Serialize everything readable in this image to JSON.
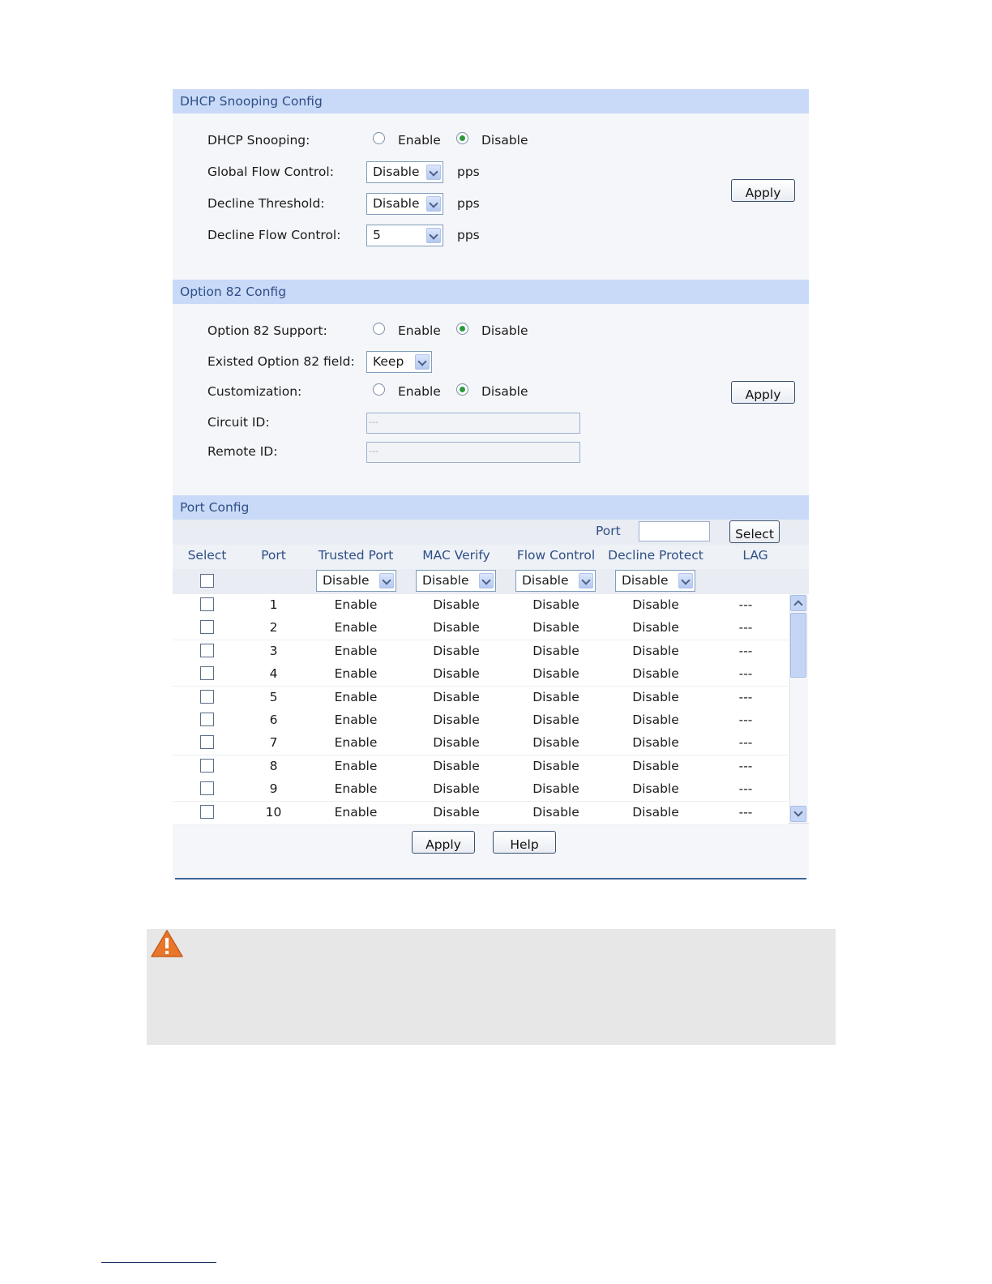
{
  "dhcp_snooping_config": {
    "title": "DHCP Snooping Config",
    "dhcp_snooping_label": "DHCP Snooping:",
    "enable_label": "Enable",
    "disable_label": "Disable",
    "selected": "Disable",
    "global_flow_control_label": "Global Flow Control:",
    "global_flow_control_value": "Disable",
    "decline_threshold_label": "Decline Threshold:",
    "decline_threshold_value": "Disable",
    "decline_flow_control_label": "Decline Flow Control:",
    "decline_flow_control_value": "5",
    "unit": "pps",
    "apply_label": "Apply"
  },
  "option82_config": {
    "title": "Option 82 Config",
    "support_label": "Option 82 Support:",
    "support_selected": "Disable",
    "existed_field_label": "Existed Option 82 field:",
    "existed_field_value": "Keep",
    "customization_label": "Customization:",
    "customization_selected": "Disable",
    "enable_label": "Enable",
    "disable_label": "Disable",
    "circuit_id_label": "Circuit ID:",
    "circuit_id_placeholder": "---",
    "remote_id_label": "Remote ID:",
    "remote_id_placeholder": "---",
    "apply_label": "Apply"
  },
  "port_config": {
    "title": "Port Config",
    "port_label": "Port",
    "select_button": "Select",
    "columns": [
      "Select",
      "Port",
      "Trusted Port",
      "MAC Verify",
      "Flow Control",
      "Decline Protect",
      "LAG"
    ],
    "batch_values": [
      "Disable",
      "Disable",
      "Disable",
      "Disable"
    ],
    "rows": [
      {
        "port": "1",
        "trusted": "Enable",
        "mac_verify": "Disable",
        "flow_control": "Disable",
        "decline_protect": "Disable",
        "lag": "---"
      },
      {
        "port": "2",
        "trusted": "Enable",
        "mac_verify": "Disable",
        "flow_control": "Disable",
        "decline_protect": "Disable",
        "lag": "---"
      },
      {
        "port": "3",
        "trusted": "Enable",
        "mac_verify": "Disable",
        "flow_control": "Disable",
        "decline_protect": "Disable",
        "lag": "---"
      },
      {
        "port": "4",
        "trusted": "Enable",
        "mac_verify": "Disable",
        "flow_control": "Disable",
        "decline_protect": "Disable",
        "lag": "---"
      },
      {
        "port": "5",
        "trusted": "Enable",
        "mac_verify": "Disable",
        "flow_control": "Disable",
        "decline_protect": "Disable",
        "lag": "---"
      },
      {
        "port": "6",
        "trusted": "Enable",
        "mac_verify": "Disable",
        "flow_control": "Disable",
        "decline_protect": "Disable",
        "lag": "---"
      },
      {
        "port": "7",
        "trusted": "Enable",
        "mac_verify": "Disable",
        "flow_control": "Disable",
        "decline_protect": "Disable",
        "lag": "---"
      },
      {
        "port": "8",
        "trusted": "Enable",
        "mac_verify": "Disable",
        "flow_control": "Disable",
        "decline_protect": "Disable",
        "lag": "---"
      },
      {
        "port": "9",
        "trusted": "Enable",
        "mac_verify": "Disable",
        "flow_control": "Disable",
        "decline_protect": "Disable",
        "lag": "---"
      },
      {
        "port": "10",
        "trusted": "Enable",
        "mac_verify": "Disable",
        "flow_control": "Disable",
        "decline_protect": "Disable",
        "lag": "---"
      }
    ],
    "apply_label": "Apply",
    "help_label": "Help"
  },
  "colors": {
    "section_header_bg": "#c9daf8",
    "section_header_text": "#2e4f86",
    "warning_icon": "#e8762b"
  },
  "icons": [
    "warning-icon",
    "chevron-down-icon",
    "scroll-up-icon",
    "scroll-down-icon"
  ]
}
